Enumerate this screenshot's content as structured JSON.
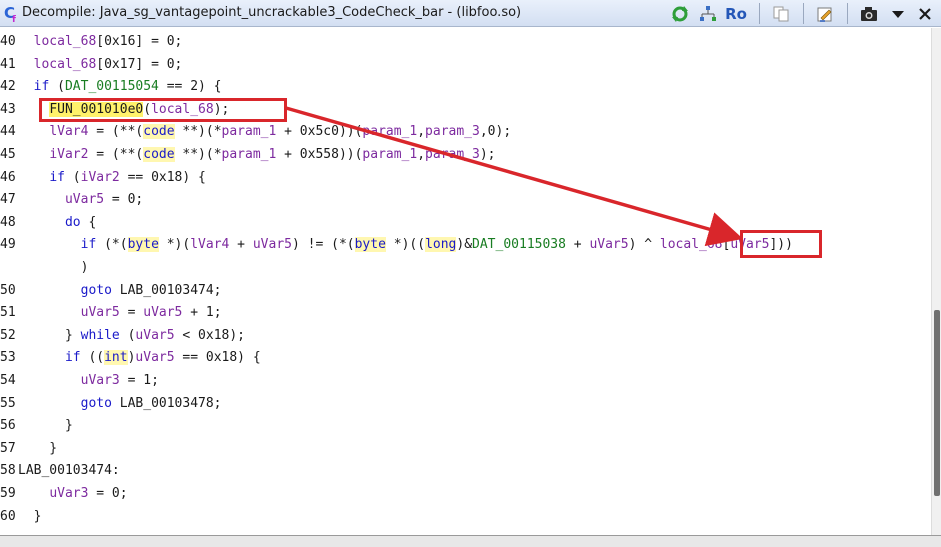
{
  "window": {
    "title": "Decompile: Java_sg_vantagepoint_uncrackable3_CodeCheck_bar -  (libfoo.so)",
    "app_icon_letter": "C",
    "app_icon_sub": "f"
  },
  "toolbar": {
    "ro_label": "Ro"
  },
  "code_lines": [
    {
      "ln": "40",
      "text": "  local_68[0x16] = 0;"
    },
    {
      "ln": "41",
      "text": "  local_68[0x17] = 0;"
    },
    {
      "ln": "42",
      "text": "  if (DAT_00115054 == 2) {"
    },
    {
      "ln": "43",
      "text": "    FUN_001010e0(local_68);"
    },
    {
      "ln": "44",
      "text": "    lVar4 = (**(code **)(*param_1 + 0x5c0))(param_1,param_3,0);"
    },
    {
      "ln": "45",
      "text": "    iVar2 = (**(code **)(*param_1 + 0x558))(param_1,param_3);"
    },
    {
      "ln": "46",
      "text": "    if (iVar2 == 0x18) {"
    },
    {
      "ln": "47",
      "text": "      uVar5 = 0;"
    },
    {
      "ln": "48",
      "text": "      do {"
    },
    {
      "ln": "49",
      "text": "        if (*(byte *)(lVar4 + uVar5) != (*(byte *)((long)&DAT_00115038 + uVar5) ^ local_68[uVar5]))"
    },
    {
      "ln": "",
      "text": "        )"
    },
    {
      "ln": "50",
      "text": "        goto LAB_00103474;"
    },
    {
      "ln": "51",
      "text": "        uVar5 = uVar5 + 1;"
    },
    {
      "ln": "52",
      "text": "      } while (uVar5 < 0x18);"
    },
    {
      "ln": "53",
      "text": "      if ((int)uVar5 == 0x18) {"
    },
    {
      "ln": "54",
      "text": "        uVar3 = 1;"
    },
    {
      "ln": "55",
      "text": "        goto LAB_00103478;"
    },
    {
      "ln": "56",
      "text": "      }"
    },
    {
      "ln": "57",
      "text": "    }"
    },
    {
      "ln": "58",
      "text": "LAB_00103474:"
    },
    {
      "ln": "59",
      "text": "    uVar3 = 0;"
    },
    {
      "ln": "60",
      "text": "  }"
    }
  ],
  "annotation_color": "#d9262b"
}
